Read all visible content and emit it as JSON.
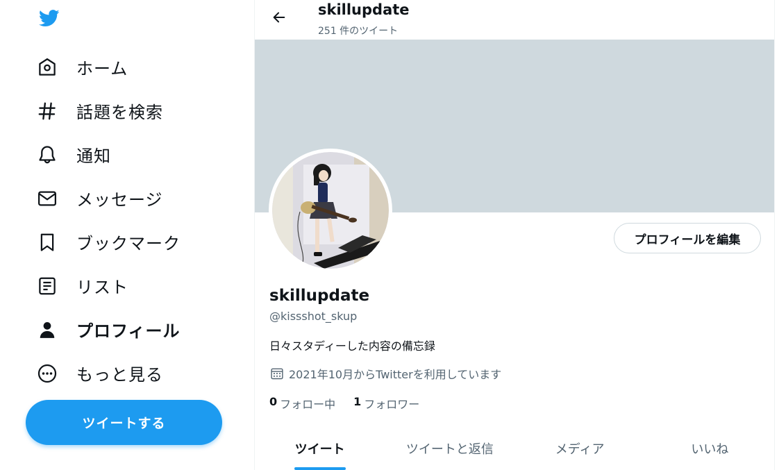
{
  "app": {
    "logo_icon": "twitter-bird-icon",
    "accent_color": "#1d9bf0"
  },
  "sidebar": {
    "items": [
      {
        "label": "ホーム",
        "icon": "home-icon",
        "active": false
      },
      {
        "label": "話題を検索",
        "icon": "hashtag-icon",
        "active": false
      },
      {
        "label": "通知",
        "icon": "bell-icon",
        "active": false
      },
      {
        "label": "メッセージ",
        "icon": "envelope-icon",
        "active": false
      },
      {
        "label": "ブックマーク",
        "icon": "bookmark-icon",
        "active": false
      },
      {
        "label": "リスト",
        "icon": "list-icon",
        "active": false
      },
      {
        "label": "プロフィール",
        "icon": "person-icon",
        "active": true
      },
      {
        "label": "もっと見る",
        "icon": "more-circle-icon",
        "active": false
      }
    ],
    "tweet_button": "ツイートする"
  },
  "header": {
    "back_icon": "arrow-left-icon",
    "name": "skillupdate",
    "tweet_count": "251 件のツイート"
  },
  "profile": {
    "banner_color": "#cfd9de",
    "edit_button": "プロフィールを編集",
    "name": "skillupdate",
    "handle": "@kissshot_skup",
    "bio": "日々スタディーした内容の備忘録",
    "joined_icon": "calendar-icon",
    "joined": "2021年10月からTwitterを利用しています",
    "following_count": "0",
    "following_label": "フォロー中",
    "followers_count": "1",
    "followers_label": "フォロワー"
  },
  "tabs": [
    {
      "label": "ツイート",
      "active": true
    },
    {
      "label": "ツイートと返信",
      "active": false
    },
    {
      "label": "メディア",
      "active": false
    },
    {
      "label": "いいね",
      "active": false
    }
  ]
}
